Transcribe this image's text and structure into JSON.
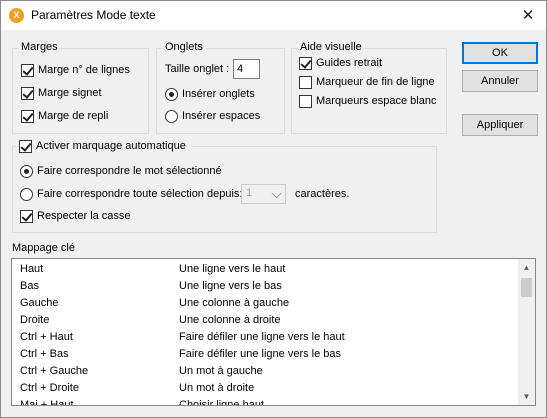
{
  "window": {
    "title": "Paramètres Mode texte",
    "close_glyph": "✕",
    "app_icon_glyph": "X"
  },
  "marges": {
    "title": "Marges",
    "items": [
      {
        "label": "Marge n° de lignes",
        "checked": true
      },
      {
        "label": "Marge signet",
        "checked": true
      },
      {
        "label": "Marge de repli",
        "checked": true
      }
    ]
  },
  "onglets": {
    "title": "Onglets",
    "taille_label": "Taille onglet :",
    "taille_value": "4",
    "inserer_onglets": "Insérer onglets",
    "inserer_espaces": "Insérer espaces",
    "selected": "inserer_onglets"
  },
  "aide": {
    "title": "Aide visuelle",
    "items": [
      {
        "label": "Guides retrait",
        "checked": true
      },
      {
        "label": "Marqueur de fin de ligne",
        "checked": false
      },
      {
        "label": "Marqueurs espace blanc",
        "checked": false
      }
    ]
  },
  "buttons": {
    "ok": "OK",
    "cancel": "Annuler",
    "apply": "Appliquer"
  },
  "marquage": {
    "activate_label": "Activer marquage automatique",
    "activate_checked": true,
    "option_word": "Faire correspondre le mot sélectionné",
    "option_any": "Faire correspondre toute sélection depuis:",
    "selected": "option_word",
    "chars_value": "1",
    "chars_suffix": "caractères.",
    "case_label": "Respecter la casse",
    "case_checked": true
  },
  "mappage": {
    "label": "Mappage clé",
    "rows": [
      {
        "key": "Haut",
        "desc": "Une ligne vers le haut"
      },
      {
        "key": "Bas",
        "desc": "Une ligne vers le bas"
      },
      {
        "key": "Gauche",
        "desc": "Une colonne à gauche"
      },
      {
        "key": "Droite",
        "desc": "Une colonne à droite"
      },
      {
        "key": "Ctrl + Haut",
        "desc": "Faire défiler une ligne vers le haut"
      },
      {
        "key": "Ctrl + Bas",
        "desc": "Faire défiler une ligne vers le bas"
      },
      {
        "key": "Ctrl + Gauche",
        "desc": "Un mot à gauche"
      },
      {
        "key": "Ctrl + Droite",
        "desc": "Un mot à droite"
      },
      {
        "key": "Maj + Haut",
        "desc": "Choisir ligne haut"
      }
    ]
  }
}
